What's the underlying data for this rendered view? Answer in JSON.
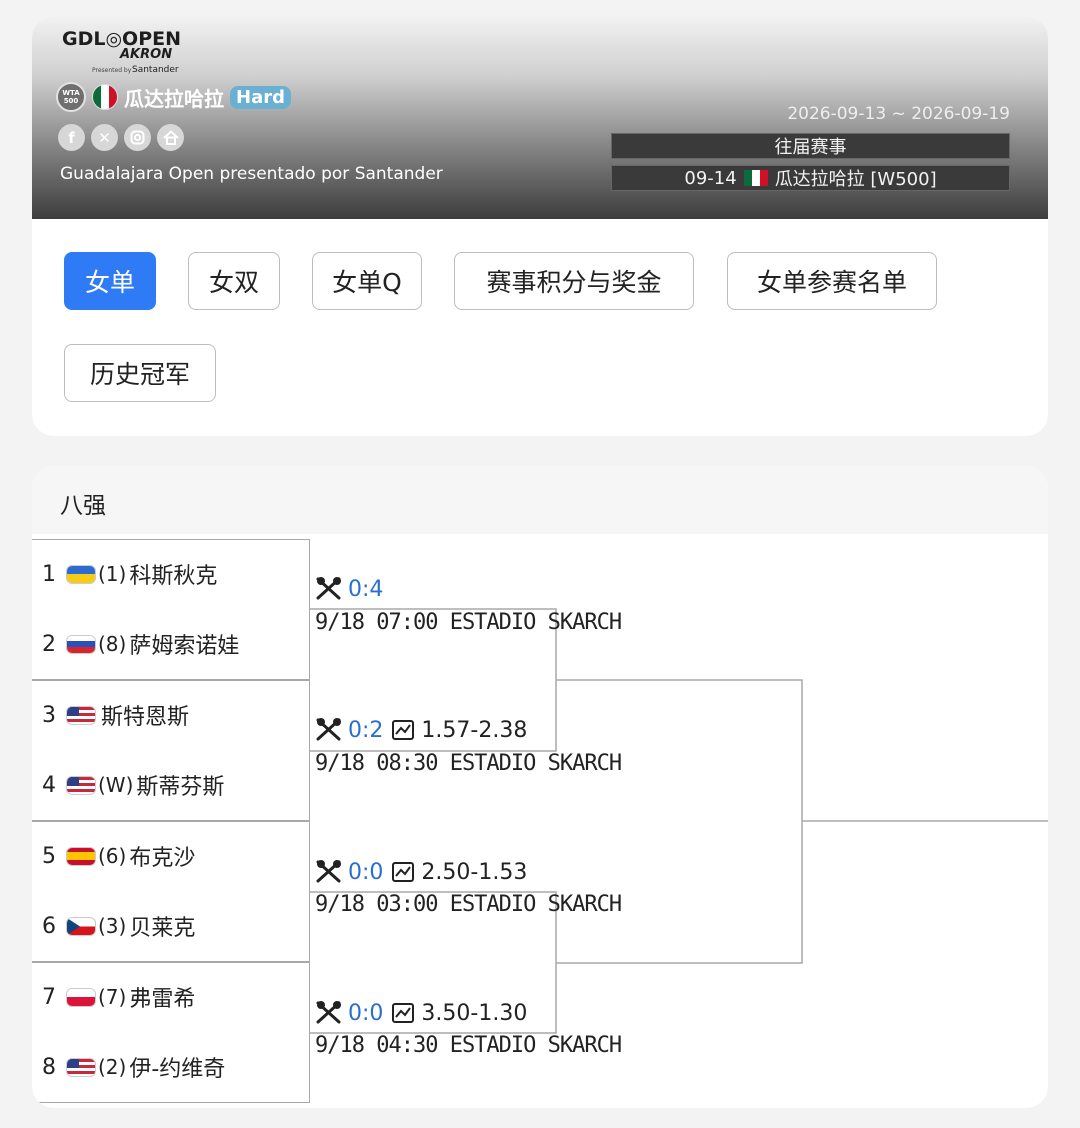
{
  "tournament": {
    "logo_line1": "GDL◎OPEN",
    "logo_line2": "AKRON",
    "logo_line3": "Presented by",
    "logo_line4": "Santander",
    "wta_badge_top": "WTA",
    "wta_badge_bottom": "500",
    "name": "瓜达拉哈拉",
    "surface": "Hard",
    "subtitle": "Guadalajara Open presentado por Santander",
    "dates": "2026-09-13 ~ 2026-09-19",
    "past_events_label": "往届赛事",
    "past_event_entry_date": "09-14",
    "past_event_entry_name": "瓜达拉哈拉 [W500]",
    "socials": [
      "facebook-icon",
      "x-icon",
      "instagram-icon",
      "home-icon"
    ]
  },
  "tabs": [
    {
      "label": "女单",
      "active": true
    },
    {
      "label": "女双",
      "active": false
    },
    {
      "label": "女单Q",
      "active": false
    },
    {
      "label": "赛事积分与奖金",
      "active": false
    },
    {
      "label": "女单参赛名单",
      "active": false
    },
    {
      "label": "历史冠军",
      "active": false
    }
  ],
  "bracket": {
    "round_title": "八强",
    "players": [
      {
        "num": "1",
        "flag": "UA",
        "seed": "(1)",
        "name": "科斯秋克"
      },
      {
        "num": "2",
        "flag": "RU",
        "seed": "(8)",
        "name": "萨姆索诺娃"
      },
      {
        "num": "3",
        "flag": "US",
        "seed": "",
        "name": "斯特恩斯"
      },
      {
        "num": "4",
        "flag": "US",
        "seed": "(W)",
        "name": "斯蒂芬斯"
      },
      {
        "num": "5",
        "flag": "ES",
        "seed": "(6)",
        "name": "布克沙"
      },
      {
        "num": "6",
        "flag": "CZ",
        "seed": "(3)",
        "name": "贝莱克"
      },
      {
        "num": "7",
        "flag": "PL",
        "seed": "(7)",
        "name": "弗雷希"
      },
      {
        "num": "8",
        "flag": "US",
        "seed": "(2)",
        "name": "伊-约维奇"
      }
    ],
    "matches": [
      {
        "h2h": "0:4",
        "odds": "",
        "info": "9/18 07:00 ESTADIO SKARCH"
      },
      {
        "h2h": "0:2",
        "odds": "1.57-2.38",
        "info": "9/18 08:30 ESTADIO SKARCH"
      },
      {
        "h2h": "0:0",
        "odds": "2.50-1.53",
        "info": "9/18 03:00 ESTADIO SKARCH"
      },
      {
        "h2h": "0:0",
        "odds": "3.50-1.30",
        "info": "9/18 04:30 ESTADIO SKARCH"
      }
    ]
  },
  "colors": {
    "accent": "#2f7bf6",
    "score": "#2a6fd0",
    "surface_badge": "#6ab0d2"
  }
}
